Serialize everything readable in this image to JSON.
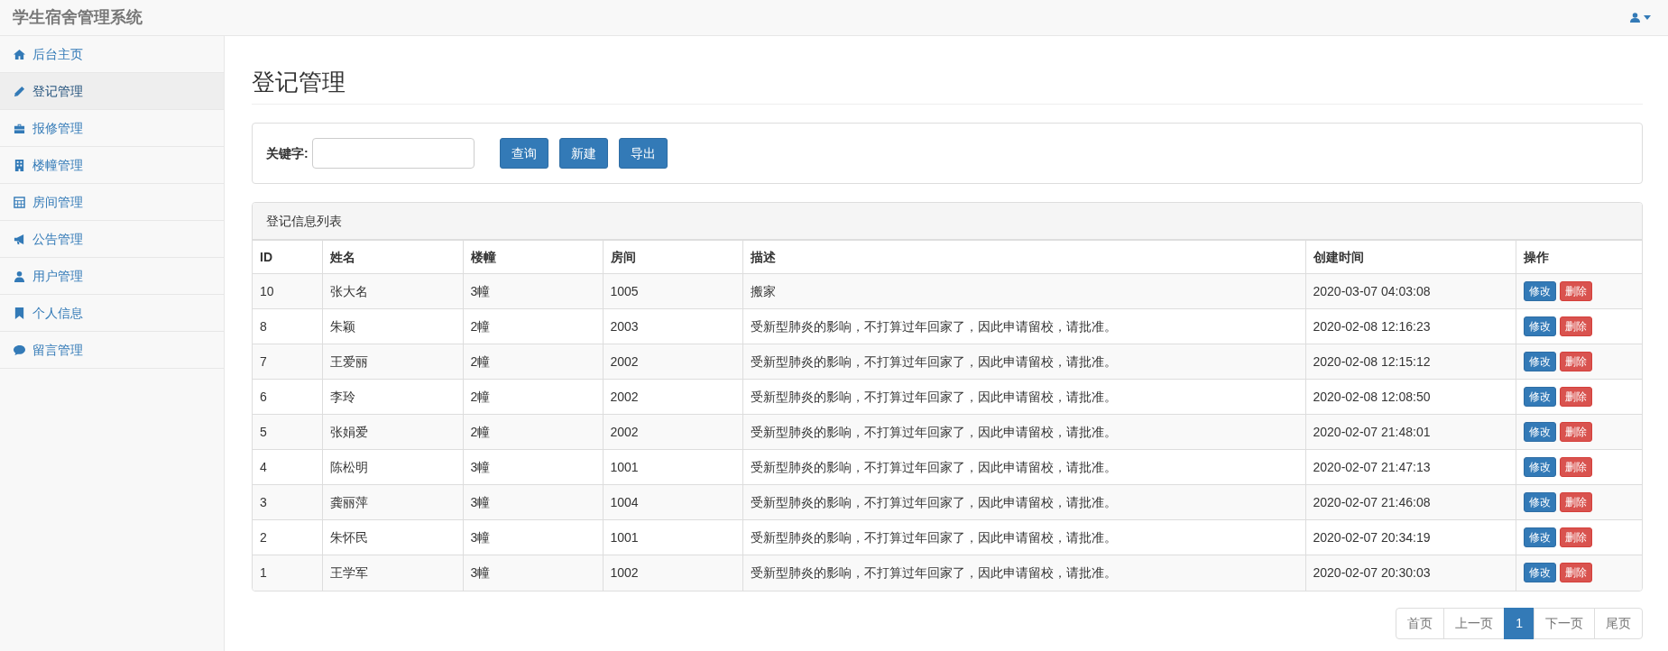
{
  "navbar": {
    "brand": "学生宿舍管理系统"
  },
  "sidebar": {
    "items": [
      {
        "label": "后台主页",
        "selected": false
      },
      {
        "label": "登记管理",
        "selected": true
      },
      {
        "label": "报修管理",
        "selected": false
      },
      {
        "label": "楼幢管理",
        "selected": false
      },
      {
        "label": "房间管理",
        "selected": false
      },
      {
        "label": "公告管理",
        "selected": false
      },
      {
        "label": "用户管理",
        "selected": false
      },
      {
        "label": "个人信息",
        "selected": false
      },
      {
        "label": "留言管理",
        "selected": false
      }
    ]
  },
  "page_title": "登记管理",
  "search": {
    "label": "关键字:",
    "buttons": [
      "查询",
      "新建",
      "导出"
    ]
  },
  "table": {
    "title": "登记信息列表",
    "columns": [
      "ID",
      "姓名",
      "楼幢",
      "房间",
      "描述",
      "创建时间",
      "操作"
    ],
    "rows": [
      {
        "cells": [
          "10",
          "张大名",
          "3幢",
          "1005",
          "搬家",
          "2020-03-07 04:03:08"
        ],
        "actions": [
          "修改",
          "删除"
        ]
      },
      {
        "cells": [
          "8",
          "朱颖",
          "2幢",
          "2003",
          "受新型肺炎的影响，不打算过年回家了，因此申请留校，请批准。",
          "2020-02-08 12:16:23"
        ],
        "actions": [
          "修改",
          "删除"
        ]
      },
      {
        "cells": [
          "7",
          "王爱丽",
          "2幢",
          "2002",
          "受新型肺炎的影响，不打算过年回家了，因此申请留校，请批准。",
          "2020-02-08 12:15:12"
        ],
        "actions": [
          "修改",
          "删除"
        ]
      },
      {
        "cells": [
          "6",
          "李玲",
          "2幢",
          "2002",
          "受新型肺炎的影响，不打算过年回家了，因此申请留校，请批准。",
          "2020-02-08 12:08:50"
        ],
        "actions": [
          "修改",
          "删除"
        ]
      },
      {
        "cells": [
          "5",
          "张娟爱",
          "2幢",
          "2002",
          "受新型肺炎的影响，不打算过年回家了，因此申请留校，请批准。",
          "2020-02-07 21:48:01"
        ],
        "actions": [
          "修改",
          "删除"
        ]
      },
      {
        "cells": [
          "4",
          "陈松明",
          "3幢",
          "1001",
          "受新型肺炎的影响，不打算过年回家了，因此申请留校，请批准。",
          "2020-02-07 21:47:13"
        ],
        "actions": [
          "修改",
          "删除"
        ]
      },
      {
        "cells": [
          "3",
          "龚丽萍",
          "3幢",
          "1004",
          "受新型肺炎的影响，不打算过年回家了，因此申请留校，请批准。",
          "2020-02-07 21:46:08"
        ],
        "actions": [
          "修改",
          "删除"
        ]
      },
      {
        "cells": [
          "2",
          "朱怀民",
          "3幢",
          "1001",
          "受新型肺炎的影响，不打算过年回家了，因此申请留校，请批准。",
          "2020-02-07 20:34:19"
        ],
        "actions": [
          "修改",
          "删除"
        ]
      },
      {
        "cells": [
          "1",
          "王学军",
          "3幢",
          "1002",
          "受新型肺炎的影响，不打算过年回家了，因此申请留校，请批准。",
          "2020-02-07 20:30:03"
        ],
        "actions": [
          "修改",
          "删除"
        ]
      }
    ]
  },
  "pagination": [
    {
      "label": "首页",
      "selected": false
    },
    {
      "label": "上一页",
      "selected": false
    },
    {
      "label": "1",
      "selected": true
    },
    {
      "label": "下一页",
      "selected": false
    },
    {
      "label": "尾页",
      "selected": false
    }
  ]
}
